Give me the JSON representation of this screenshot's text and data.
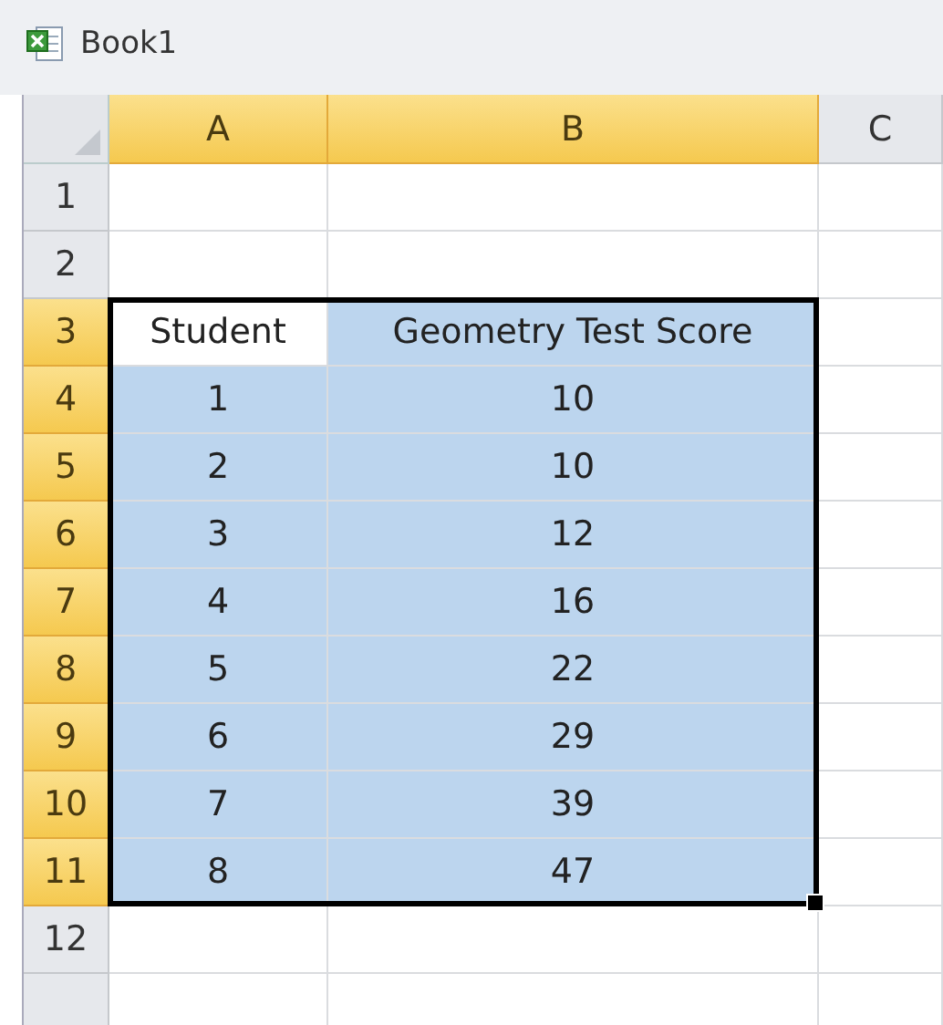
{
  "window": {
    "title": "Book1"
  },
  "columns": [
    {
      "label": "A",
      "selected": true
    },
    {
      "label": "B",
      "selected": true
    },
    {
      "label": "C",
      "selected": false
    }
  ],
  "rows": [
    {
      "label": "1",
      "selected": false,
      "cells": [
        {
          "selected": false
        },
        {
          "selected": false
        },
        {
          "selected": false
        }
      ]
    },
    {
      "label": "2",
      "selected": false,
      "cells": [
        {
          "selected": false
        },
        {
          "selected": false
        },
        {
          "selected": false
        }
      ]
    },
    {
      "label": "3",
      "selected": true,
      "cells": [
        {
          "text": "Student",
          "selected": true,
          "active": true
        },
        {
          "text": "Geometry Test Score",
          "selected": true,
          "active": false
        },
        {
          "selected": false
        }
      ]
    },
    {
      "label": "4",
      "selected": true,
      "cells": [
        {
          "text": "1",
          "selected": true,
          "active": false
        },
        {
          "text": "10",
          "selected": true,
          "active": false
        },
        {
          "selected": false
        }
      ]
    },
    {
      "label": "5",
      "selected": true,
      "cells": [
        {
          "text": "2",
          "selected": true,
          "active": false
        },
        {
          "text": "10",
          "selected": true,
          "active": false
        },
        {
          "selected": false
        }
      ]
    },
    {
      "label": "6",
      "selected": true,
      "cells": [
        {
          "text": "3",
          "selected": true,
          "active": false
        },
        {
          "text": "12",
          "selected": true,
          "active": false
        },
        {
          "selected": false
        }
      ]
    },
    {
      "label": "7",
      "selected": true,
      "cells": [
        {
          "text": "4",
          "selected": true,
          "active": false
        },
        {
          "text": "16",
          "selected": true,
          "active": false
        },
        {
          "selected": false
        }
      ]
    },
    {
      "label": "8",
      "selected": true,
      "cells": [
        {
          "text": "5",
          "selected": true,
          "active": false
        },
        {
          "text": "22",
          "selected": true,
          "active": false
        },
        {
          "selected": false
        }
      ]
    },
    {
      "label": "9",
      "selected": true,
      "cells": [
        {
          "text": "6",
          "selected": true,
          "active": false
        },
        {
          "text": "29",
          "selected": true,
          "active": false
        },
        {
          "selected": false
        }
      ]
    },
    {
      "label": "10",
      "selected": true,
      "cells": [
        {
          "text": "7",
          "selected": true,
          "active": false
        },
        {
          "text": "39",
          "selected": true,
          "active": false
        },
        {
          "selected": false
        }
      ]
    },
    {
      "label": "11",
      "selected": true,
      "cells": [
        {
          "text": "8",
          "selected": true,
          "active": false
        },
        {
          "text": "47",
          "selected": true,
          "active": false
        },
        {
          "selected": false
        }
      ]
    },
    {
      "label": "12",
      "selected": false,
      "cells": [
        {
          "selected": false
        },
        {
          "selected": false
        },
        {
          "selected": false
        }
      ]
    },
    {
      "selected": false,
      "cells": [
        {
          "selected": false
        },
        {
          "selected": false
        },
        {
          "selected": false
        }
      ]
    }
  ]
}
